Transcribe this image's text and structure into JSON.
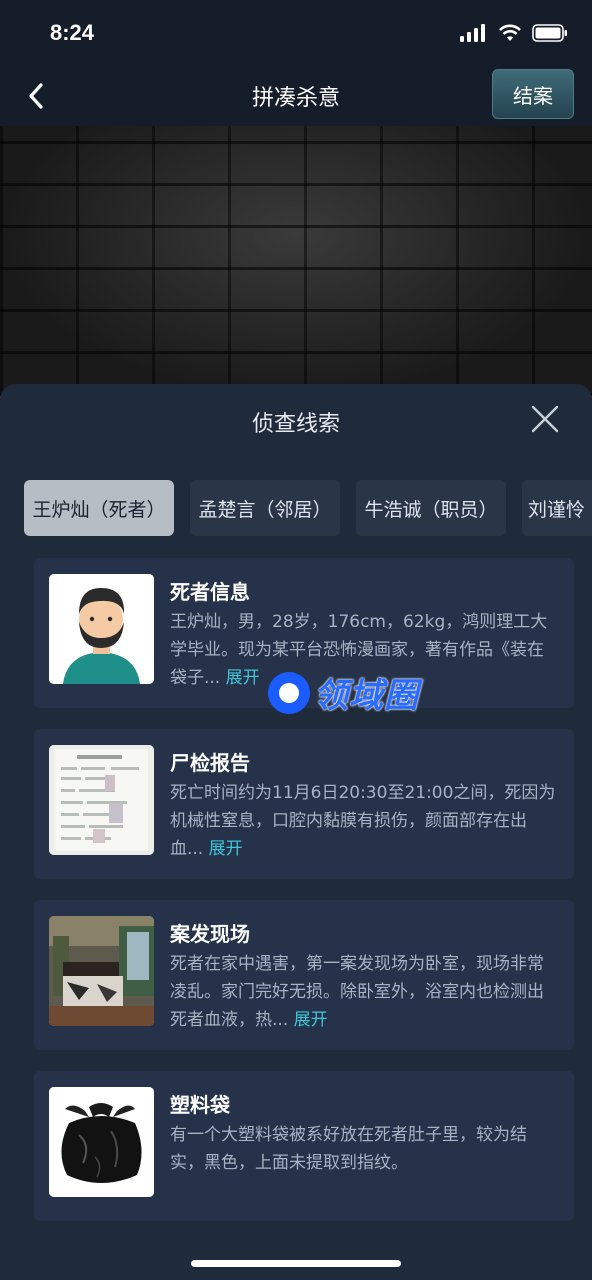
{
  "status": {
    "time": "8:24"
  },
  "nav": {
    "title": "拼凑杀意",
    "close_case_label": "结案"
  },
  "sheet": {
    "title": "侦查线索"
  },
  "tabs": [
    {
      "label": "王炉灿（死者）"
    },
    {
      "label": "孟楚言（邻居）"
    },
    {
      "label": "牛浩诚（职员）"
    },
    {
      "label": "刘谨怜"
    }
  ],
  "clues": [
    {
      "title": "死者信息",
      "desc": "王炉灿，男，28岁，176cm，62kg，鸿则理工大学毕业。现为某平台恐怖漫画家，著有作品《装在袋子...",
      "expand": "展开",
      "thumb": "avatar-man-beard"
    },
    {
      "title": "尸检报告",
      "desc": "死亡时间约为11月6日20:30至21:00之间，死因为机械性窒息，口腔内黏膜有损伤，颜面部存在出血...",
      "expand": "展开",
      "thumb": "report-document"
    },
    {
      "title": "案发现场",
      "desc": "死者在家中遇害，第一案发现场为卧室，现场非常凌乱。家门完好无损。除卧室外，浴室内也检测出死者血液，热...",
      "expand": "展开",
      "thumb": "bedroom-photo"
    },
    {
      "title": "塑料袋",
      "desc": "有一个大塑料袋被系好放在死者肚子里，较为结实，黑色，上面未提取到指纹。",
      "expand": "",
      "thumb": "black-plastic-bag"
    }
  ],
  "watermark": {
    "text": "领域圈"
  },
  "colors": {
    "accent": "#3ec5d8",
    "card": "#26324a",
    "sheet": "#1f2a3b",
    "tab_active": "#b6bdc4"
  }
}
